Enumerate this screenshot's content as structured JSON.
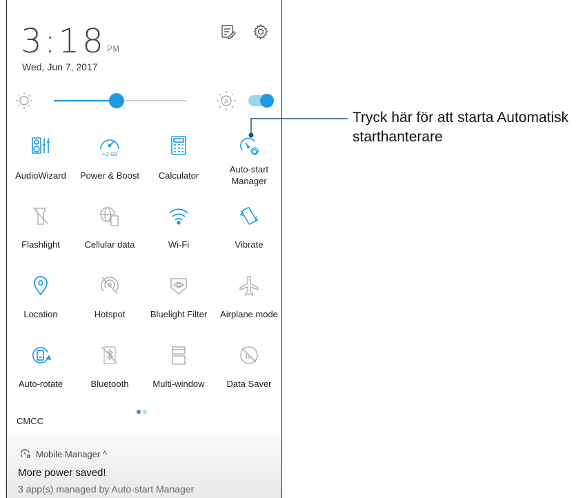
{
  "header": {
    "time_digits": "3:18",
    "time_ampm": "PM",
    "date": "Wed, Jun 7, 2017",
    "edit_icon": "edit-list-icon",
    "settings_icon": "gear-icon"
  },
  "brightness": {
    "level": 0.45,
    "auto_enabled": true
  },
  "tiles": [
    {
      "label": "AudioWizard",
      "icon": "audiowizard-icon",
      "active": true
    },
    {
      "label": "Power & Boost",
      "icon": "speedometer-icon",
      "active": true,
      "badge": ">2 GB"
    },
    {
      "label": "Calculator",
      "icon": "calculator-icon",
      "active": true
    },
    {
      "label": "Auto-start\nManager",
      "icon": "auto-start-manager-icon",
      "active": true
    },
    {
      "label": "Flashlight",
      "icon": "flashlight-off-icon",
      "active": false
    },
    {
      "label": "Cellular data",
      "icon": "cellular-data-icon",
      "active": false
    },
    {
      "label": "Wi-Fi",
      "icon": "wifi-icon",
      "active": true
    },
    {
      "label": "Vibrate",
      "icon": "vibrate-icon",
      "active": true
    },
    {
      "label": "Location",
      "icon": "location-pin-icon",
      "active": true
    },
    {
      "label": "Hotspot",
      "icon": "hotspot-off-icon",
      "active": false
    },
    {
      "label": "Bluelight Filter",
      "icon": "eye-filter-icon",
      "active": false
    },
    {
      "label": "Airplane mode",
      "icon": "airplane-icon",
      "active": false
    },
    {
      "label": "Auto-rotate",
      "icon": "auto-rotate-icon",
      "active": true
    },
    {
      "label": "Bluetooth",
      "icon": "bluetooth-off-icon",
      "active": false
    },
    {
      "label": "Multi-window",
      "icon": "multi-window-icon",
      "active": false
    },
    {
      "label": "Data Saver",
      "icon": "data-saver-off-icon",
      "active": false
    }
  ],
  "carrier": "CMCC",
  "notification": {
    "app_name": "Mobile Manager ^",
    "title": "More power saved!",
    "text": "3 app(s) managed by Auto-start Manager"
  },
  "callout": {
    "line1": "Tryck här för att starta Automatisk",
    "line2": "starthanterare"
  },
  "colors": {
    "accent": "#1e9be0",
    "inactive": "#b4b4b4",
    "callout_line": "#1d4f8f"
  }
}
